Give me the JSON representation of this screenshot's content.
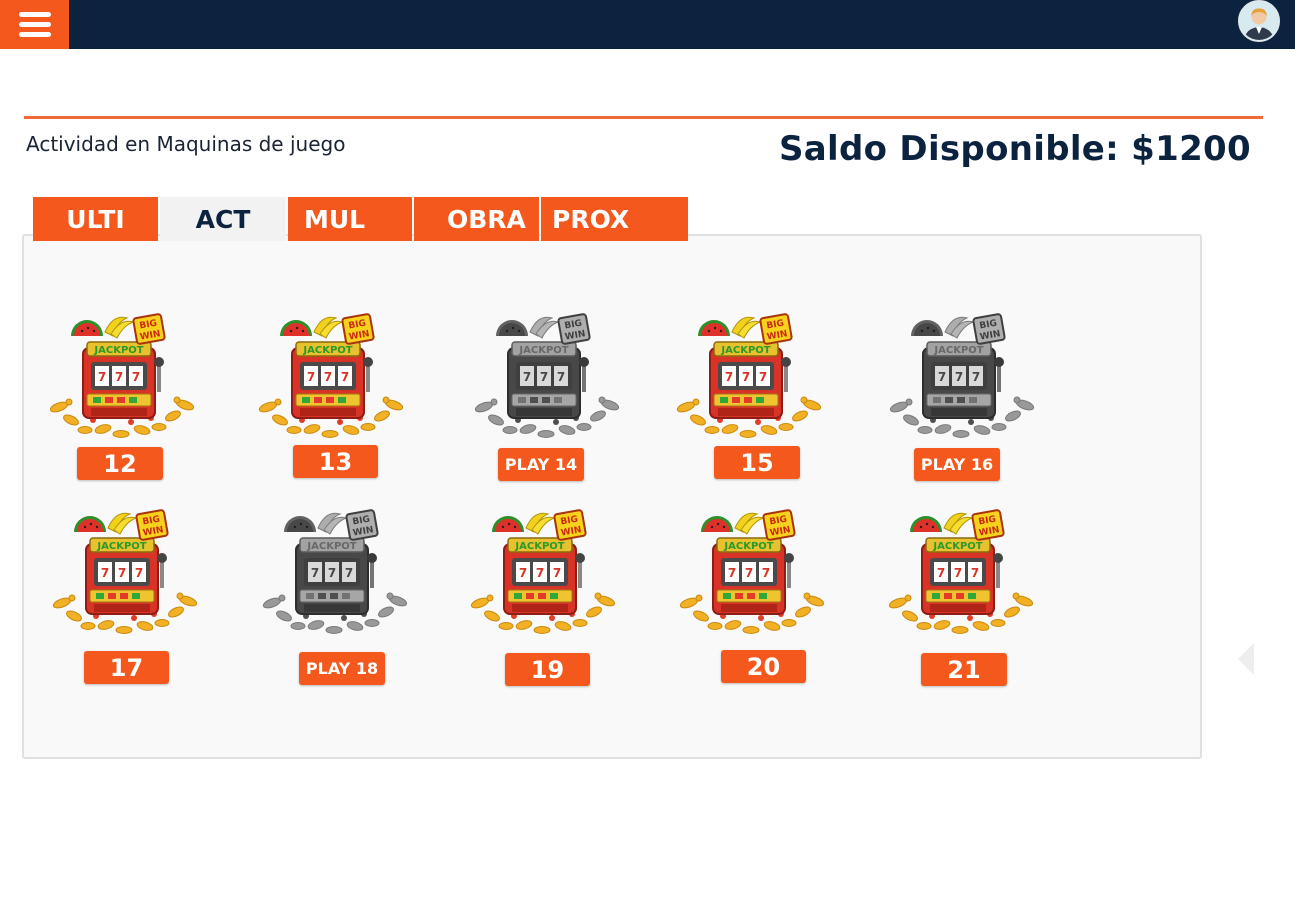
{
  "header": {
    "menu_icon": "hamburger-menu-icon",
    "avatar_icon": "user-avatar-icon",
    "brand_color": "#0c2340",
    "accent_color": "#f4581c"
  },
  "page": {
    "section_title": "Actividad en Maquinas de juego",
    "balance_text": "Saldo Disponible: $1200"
  },
  "tabs": [
    {
      "label": "ULTI",
      "active": false
    },
    {
      "label": "ACT",
      "active": true
    },
    {
      "label": "MUL",
      "active": false
    },
    {
      "label": "OBRA",
      "active": false
    },
    {
      "label": "PROX",
      "active": false
    }
  ],
  "machines": [
    {
      "label": "12",
      "available": true
    },
    {
      "label": "13",
      "available": true
    },
    {
      "label": "PLAY 14",
      "available": false
    },
    {
      "label": "15",
      "available": true
    },
    {
      "label": "PLAY 16",
      "available": false
    },
    {
      "label": "17",
      "available": true
    },
    {
      "label": "PLAY 18",
      "available": false
    },
    {
      "label": "19",
      "available": true
    },
    {
      "label": "20",
      "available": true
    },
    {
      "label": "21",
      "available": true
    }
  ],
  "slot_icon": "jackpot-slot-machine-icon"
}
